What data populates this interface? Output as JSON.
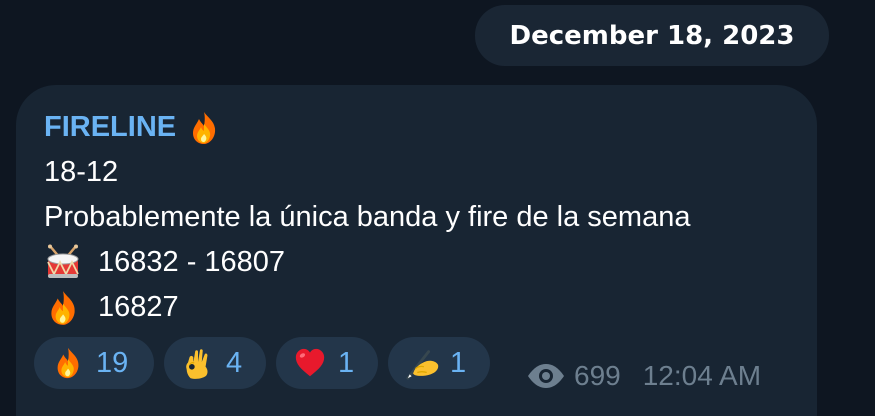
{
  "date_header": "December 18, 2023",
  "message": {
    "sender": "FIRELINE",
    "sender_icon": "fire-icon",
    "lines": [
      {
        "text": "18-12"
      },
      {
        "text": "Probablemente la única banda y fire de la semana"
      },
      {
        "icon": "drum-icon",
        "text": "16832 - 16807"
      },
      {
        "icon": "fire-icon",
        "text": "16827"
      }
    ],
    "reactions": [
      {
        "icon": "fire-icon",
        "count": "19"
      },
      {
        "icon": "ok-hand-icon",
        "count": "4"
      },
      {
        "icon": "red-heart-icon",
        "count": "1"
      },
      {
        "icon": "writing-hand-icon",
        "count": "1"
      }
    ],
    "views": "699",
    "time": "12:04 AM"
  },
  "colors": {
    "background": "#0e1621",
    "bubble": "#182533",
    "date_pill": "#1a2634",
    "accent": "#6ab3f3",
    "reaction_bg": "#23364a",
    "meta": "#6d7f8f"
  }
}
